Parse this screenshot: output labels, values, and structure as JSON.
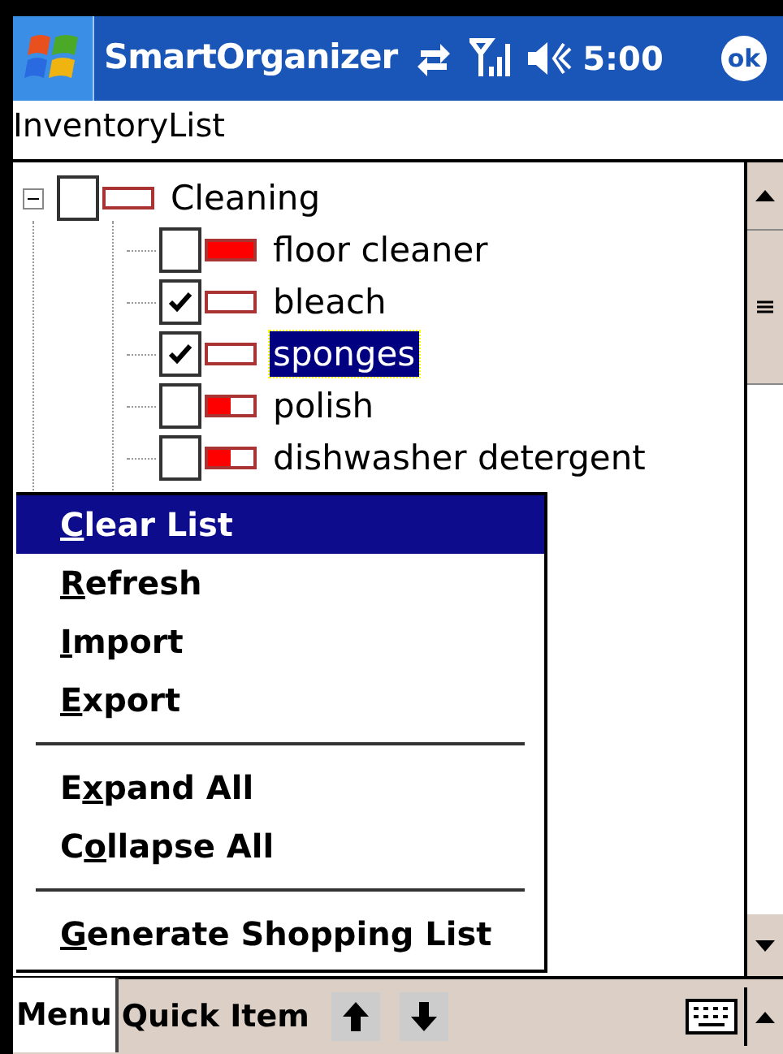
{
  "title_bar": {
    "app_name": "SmartOrganizer",
    "time": "5:00",
    "ok_label": "ok"
  },
  "form_title": "InventoryList",
  "tree": [
    {
      "label": "Cleaning",
      "expanded": true,
      "checked": false,
      "level": 0,
      "selected": false,
      "children": [
        {
          "label": "floor cleaner",
          "checked": false,
          "level": 1,
          "selected": false
        },
        {
          "label": "bleach",
          "checked": true,
          "level": 0,
          "selected": false
        },
        {
          "label": "sponges",
          "checked": true,
          "level": 0,
          "selected": true
        },
        {
          "label": "polish",
          "checked": false,
          "level": 0.5,
          "selected": false
        },
        {
          "label": "dishwasher detergent",
          "checked": false,
          "level": 0.5,
          "selected": false
        }
      ]
    }
  ],
  "menu": [
    {
      "kind": "item",
      "key": "C",
      "after": "lear List",
      "selected": true
    },
    {
      "kind": "item",
      "key": "R",
      "after": "efresh",
      "selected": false
    },
    {
      "kind": "item",
      "key": "I",
      "after": "mport",
      "selected": false
    },
    {
      "kind": "item",
      "key": "E",
      "after": "xport",
      "selected": false
    },
    {
      "kind": "separator"
    },
    {
      "kind": "item",
      "before": "E",
      "key": "x",
      "after": "pand All",
      "selected": false
    },
    {
      "kind": "item",
      "before": "C",
      "key": "o",
      "after": "llapse All",
      "selected": false
    },
    {
      "kind": "separator"
    },
    {
      "kind": "item",
      "key": "G",
      "after": "enerate Shopping List",
      "selected": false
    }
  ],
  "menu_bar": {
    "items": [
      {
        "label": "Menu",
        "selected": true
      },
      {
        "label": "Quick Item",
        "selected": false
      }
    ]
  }
}
